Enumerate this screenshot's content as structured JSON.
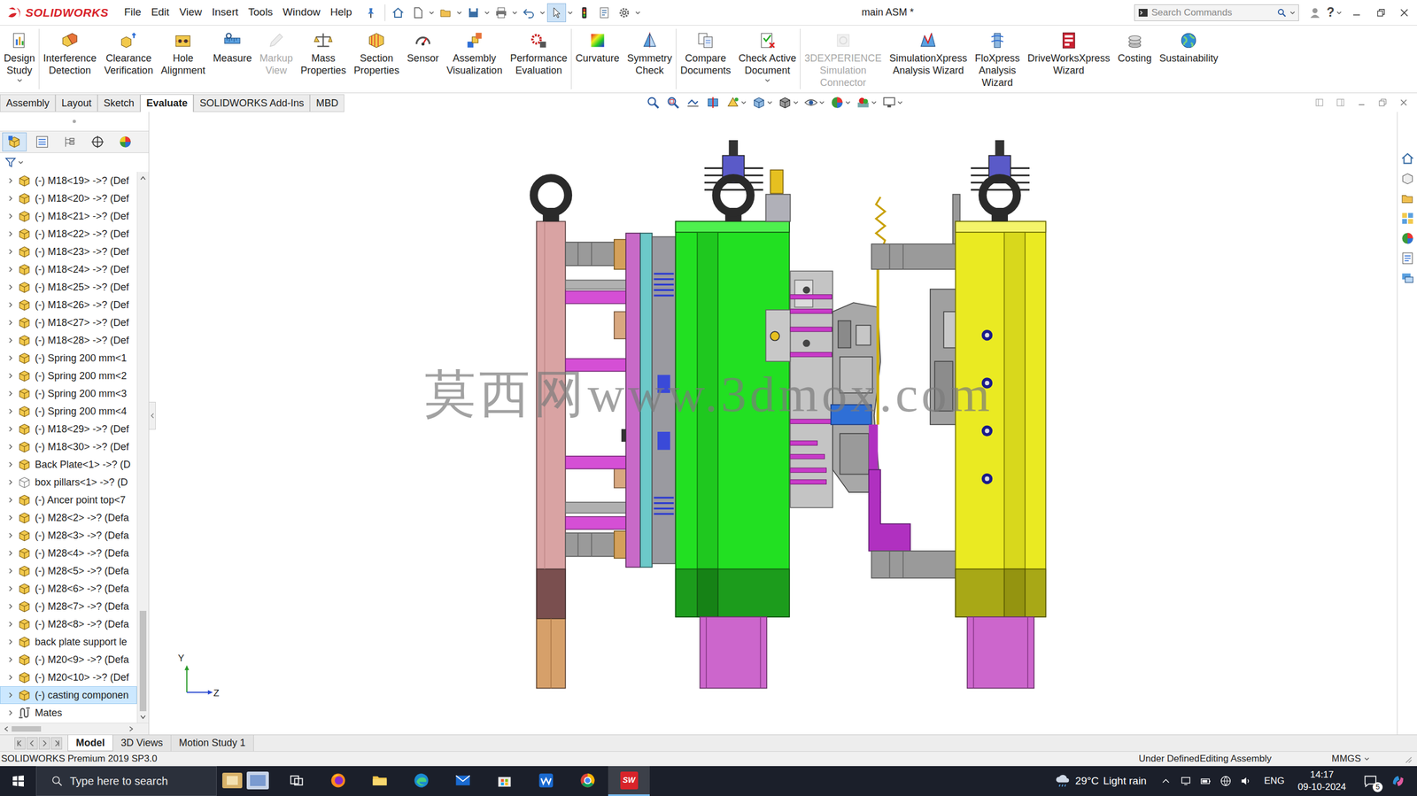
{
  "window": {
    "app": "SOLIDWORKS",
    "title": "main ASM *",
    "help": "?"
  },
  "menu": [
    "File",
    "Edit",
    "View",
    "Insert",
    "Tools",
    "Window",
    "Help"
  ],
  "quick_access": [
    {
      "kind": "home",
      "active": false
    },
    {
      "kind": "new",
      "active": false
    },
    {
      "kind": "open",
      "active": false
    },
    {
      "kind": "save",
      "active": false
    },
    {
      "kind": "print",
      "active": false
    },
    {
      "kind": "undo",
      "active": false
    },
    {
      "kind": "select",
      "active": true
    },
    {
      "kind": "rebuild",
      "active": false
    },
    {
      "kind": "file-props",
      "active": false
    },
    {
      "kind": "options",
      "active": false
    }
  ],
  "search": {
    "placeholder": "Search Commands"
  },
  "ribbon": {
    "groups": [
      {
        "buttons": [
          {
            "label": "Design\nStudy",
            "disabled": false,
            "dropdown": true
          }
        ]
      },
      {
        "buttons": [
          {
            "label": "Interference\nDetection",
            "disabled": false,
            "dropdown": false
          },
          {
            "label": "Clearance\nVerification",
            "disabled": false,
            "dropdown": false
          },
          {
            "label": "Hole\nAlignment",
            "disabled": false,
            "dropdown": false
          },
          {
            "label": "Measure",
            "disabled": false,
            "dropdown": false
          },
          {
            "label": "Markup\nView",
            "disabled": true,
            "dropdown": false
          },
          {
            "label": "Mass\nProperties",
            "disabled": false,
            "dropdown": false
          },
          {
            "label": "Section\nProperties",
            "disabled": false,
            "dropdown": false
          },
          {
            "label": "Sensor",
            "disabled": false,
            "dropdown": false
          },
          {
            "label": "Assembly\nVisualization",
            "disabled": false,
            "dropdown": false
          },
          {
            "label": "Performance\nEvaluation",
            "disabled": false,
            "dropdown": false
          }
        ]
      },
      {
        "buttons": [
          {
            "label": "Curvature",
            "disabled": false,
            "dropdown": false
          },
          {
            "label": "Symmetry\nCheck",
            "disabled": false,
            "dropdown": false
          }
        ]
      },
      {
        "buttons": [
          {
            "label": "Compare\nDocuments",
            "disabled": false,
            "dropdown": false
          },
          {
            "label": "Check Active\nDocument",
            "disabled": false,
            "dropdown": true
          }
        ]
      },
      {
        "buttons": [
          {
            "label": "3DEXPERIENCE\nSimulation\nConnector",
            "disabled": true,
            "dropdown": false
          },
          {
            "label": "SimulationXpress\nAnalysis Wizard",
            "disabled": false,
            "dropdown": false
          },
          {
            "label": "FloXpress\nAnalysis\nWizard",
            "disabled": false,
            "dropdown": false
          },
          {
            "label": "DriveWorksXpress\nWizard",
            "disabled": false,
            "dropdown": false
          },
          {
            "label": "Costing",
            "disabled": false,
            "dropdown": false
          },
          {
            "label": "Sustainability",
            "disabled": false,
            "dropdown": false
          }
        ]
      }
    ]
  },
  "command_tabs": [
    {
      "label": "Assembly",
      "selected": false
    },
    {
      "label": "Layout",
      "selected": false
    },
    {
      "label": "Sketch",
      "selected": false
    },
    {
      "label": "Evaluate",
      "selected": true
    },
    {
      "label": "SOLIDWORKS Add-Ins",
      "selected": false
    },
    {
      "label": "MBD",
      "selected": false
    }
  ],
  "feature_tree": {
    "panel_tabs": [
      {
        "selected": true
      },
      {
        "selected": false
      },
      {
        "selected": false
      },
      {
        "selected": false
      },
      {
        "selected": false
      }
    ],
    "items": [
      {
        "label": "(-) M18<19> ->? (Def",
        "kind": "part",
        "expanded": false,
        "selected": false
      },
      {
        "label": "(-) M18<20> ->? (Def",
        "kind": "part",
        "expanded": false,
        "selected": false
      },
      {
        "label": "(-) M18<21> ->? (Def",
        "kind": "part",
        "expanded": false,
        "selected": false
      },
      {
        "label": "(-) M18<22> ->? (Def",
        "kind": "part",
        "expanded": false,
        "selected": false
      },
      {
        "label": "(-) M18<23> ->? (Def",
        "kind": "part",
        "expanded": false,
        "selected": false
      },
      {
        "label": "(-) M18<24> ->? (Def",
        "kind": "part",
        "expanded": false,
        "selected": false
      },
      {
        "label": "(-) M18<25> ->? (Def",
        "kind": "part",
        "expanded": false,
        "selected": false
      },
      {
        "label": "(-) M18<26> ->? (Def",
        "kind": "part",
        "expanded": false,
        "selected": false
      },
      {
        "label": "(-) M18<27> ->? (Def",
        "kind": "part",
        "expanded": false,
        "selected": false
      },
      {
        "label": "(-) M18<28> ->? (Def",
        "kind": "part",
        "expanded": false,
        "selected": false
      },
      {
        "label": "(-) Spring 200 mm<1",
        "kind": "part",
        "expanded": false,
        "selected": false
      },
      {
        "label": "(-) Spring 200 mm<2",
        "kind": "part",
        "expanded": false,
        "selected": false
      },
      {
        "label": "(-) Spring 200 mm<3",
        "kind": "part",
        "expanded": false,
        "selected": false
      },
      {
        "label": "(-) Spring 200 mm<4",
        "kind": "part",
        "expanded": false,
        "selected": false
      },
      {
        "label": "(-) M18<29> ->? (Def",
        "kind": "part",
        "expanded": false,
        "selected": false
      },
      {
        "label": "(-) M18<30> ->? (Def",
        "kind": "part",
        "expanded": false,
        "selected": false
      },
      {
        "label": "Back Plate<1> ->? (D",
        "kind": "part",
        "expanded": false,
        "selected": false
      },
      {
        "label": "box pillars<1> ->? (D",
        "kind": "hidden-part",
        "expanded": false,
        "selected": false
      },
      {
        "label": "(-) Ancer point top<7",
        "kind": "part",
        "expanded": false,
        "selected": false
      },
      {
        "label": "(-) M28<2> ->? (Defa",
        "kind": "part",
        "expanded": false,
        "selected": false
      },
      {
        "label": "(-) M28<3> ->? (Defa",
        "kind": "part",
        "expanded": false,
        "selected": false
      },
      {
        "label": "(-) M28<4> ->? (Defa",
        "kind": "part",
        "expanded": false,
        "selected": false
      },
      {
        "label": "(-) M28<5> ->? (Defa",
        "kind": "part",
        "expanded": false,
        "selected": false
      },
      {
        "label": "(-) M28<6> ->? (Defa",
        "kind": "part",
        "expanded": false,
        "selected": false
      },
      {
        "label": "(-) M28<7> ->? (Defa",
        "kind": "part",
        "expanded": false,
        "selected": false
      },
      {
        "label": "(-) M28<8> ->? (Defa",
        "kind": "part",
        "expanded": false,
        "selected": false
      },
      {
        "label": "back plate support le",
        "kind": "part",
        "expanded": false,
        "selected": false
      },
      {
        "label": "(-) M20<9> ->? (Defa",
        "kind": "part",
        "expanded": false,
        "selected": false
      },
      {
        "label": "(-) M20<10> ->? (Def",
        "kind": "part",
        "expanded": false,
        "selected": false
      },
      {
        "label": "(-) casting componen",
        "kind": "part",
        "expanded": false,
        "selected": true
      },
      {
        "label": "Mates",
        "kind": "mates",
        "expanded": false,
        "selected": false
      }
    ],
    "vertical_scroll": {
      "level": 1,
      "visible_share": 0.19
    },
    "horizontal_scroll": {
      "level": 0,
      "visible_share": 0.26
    }
  },
  "viewport": {
    "triad": {
      "y": "Y",
      "z": "Z"
    },
    "watermark": "莫西网www.3dmox.com"
  },
  "bottom_tabs": [
    {
      "label": "Model",
      "selected": true
    },
    {
      "label": "3D Views",
      "selected": false
    },
    {
      "label": "Motion Study 1",
      "selected": false
    }
  ],
  "status_bar": {
    "product": "SOLIDWORKS Premium 2019 SP3.0",
    "state": "Under Defined",
    "mode": "Editing Assembly",
    "units": "MMGS"
  },
  "taskbar": {
    "search_placeholder": "Type here to search",
    "apps": [
      {
        "kind": "widgets",
        "active": false
      },
      {
        "kind": "task-view",
        "active": false
      },
      {
        "kind": "firefox",
        "active": false
      },
      {
        "kind": "folder",
        "active": false
      },
      {
        "kind": "edge",
        "active": false
      },
      {
        "kind": "mail",
        "active": false
      },
      {
        "kind": "store",
        "active": false
      },
      {
        "kind": "wave",
        "active": false
      },
      {
        "kind": "chrome",
        "active": false
      },
      {
        "kind": "solidworks",
        "active": true,
        "badge": "SW"
      }
    ],
    "weather": {
      "temp": "29°C",
      "text": "Light rain"
    },
    "language": "ENG",
    "time": "14:17",
    "date": "09-10-2024",
    "notifications": "5"
  }
}
